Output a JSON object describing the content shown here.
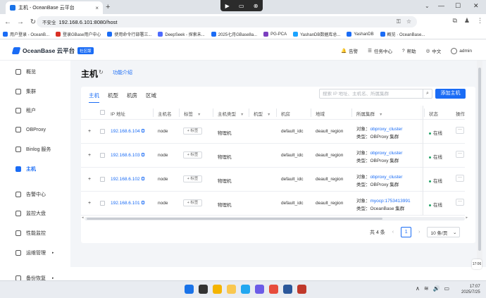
{
  "browser": {
    "tab_title": "主机 - OceanBase 云平台",
    "tab_close": "×",
    "new_tab": "+",
    "tab_search": "⌄",
    "win_min": "—",
    "win_max": "☐",
    "win_close": "✕",
    "back": "←",
    "forward": "→",
    "reload": "↻",
    "security_label": "不安全",
    "url": "192.168.6.101:8080/host",
    "omni_right": [
      "⚿",
      "☆"
    ],
    "right_icons": [
      "⧉",
      "♟",
      "⋮"
    ]
  },
  "overlay_icons": [
    "▶",
    "▭",
    "⊗"
  ],
  "bookmarks": [
    {
      "label": "用户登录 - OceanB...",
      "color": "#1a6cf5"
    },
    {
      "label": "登录GBase用户中心",
      "color": "#d93025"
    },
    {
      "label": "使用命令行部署三...",
      "color": "#1a6cf5"
    },
    {
      "label": "DeepSeek - 探索未...",
      "color": "#4d6bfe"
    },
    {
      "label": "2025七月GBase8a...",
      "color": "#1a6cf5"
    },
    {
      "label": "PG-PCA",
      "color": "#7b3fbf"
    },
    {
      "label": "YashanDB数据库总...",
      "color": "#1aa3ff"
    },
    {
      "label": "YashanDB",
      "color": "#1a6cf5"
    },
    {
      "label": "概览 · OceanBase...",
      "color": "#1a6cf5"
    }
  ],
  "app": {
    "logo_name": "OceanBase 云平台",
    "edition": "社区版",
    "header_items": [
      {
        "icon": "bell-icon",
        "glyph": "🔔",
        "label": "告警"
      },
      {
        "icon": "task-icon",
        "glyph": "☰",
        "label": "任务中心"
      },
      {
        "icon": "help-icon",
        "glyph": "?",
        "label": "帮助"
      },
      {
        "icon": "language-icon",
        "glyph": "◎",
        "label": "中文"
      },
      {
        "icon": "user-icon",
        "glyph": "",
        "label": "admin"
      }
    ]
  },
  "sidebar": {
    "items": [
      {
        "label": "概览",
        "icon": "overview-icon",
        "active": false,
        "arrow": ""
      },
      {
        "label": "集群",
        "icon": "cluster-icon",
        "active": false,
        "arrow": ""
      },
      {
        "label": "租户",
        "icon": "tenant-icon",
        "active": false,
        "arrow": ""
      },
      {
        "label": "OBProxy",
        "icon": "obproxy-icon",
        "active": false,
        "arrow": ""
      },
      {
        "label": "Binlog 服务",
        "icon": "binlog-icon",
        "active": false,
        "arrow": ""
      },
      {
        "label": "主机",
        "icon": "host-icon",
        "active": true,
        "arrow": ""
      },
      {
        "label": "告警中心",
        "icon": "alarm-icon",
        "active": false,
        "arrow": ""
      },
      {
        "label": "监控大盘",
        "icon": "monitor-icon",
        "active": false,
        "arrow": ""
      },
      {
        "label": "性能监控",
        "icon": "performance-icon",
        "active": false,
        "arrow": ""
      },
      {
        "label": "运维管理",
        "icon": "ops-icon",
        "active": false,
        "arrow": "▸"
      },
      {
        "label": "备份恢复",
        "icon": "backup-icon",
        "active": false,
        "arrow": "▸"
      }
    ]
  },
  "page": {
    "title": "主机",
    "refresh_glyph": "↻",
    "intro_link": "功能介绍",
    "tabs": [
      {
        "label": "主机",
        "active": true
      },
      {
        "label": "机型",
        "active": false
      },
      {
        "label": "机房",
        "active": false
      },
      {
        "label": "区域",
        "active": false
      }
    ],
    "search_placeholder": "搜索 IP 地址、主机名、所属集群",
    "search_glyph": "⌕",
    "add_button": "添加主机"
  },
  "table": {
    "columns": [
      "IP 地址",
      "主机名",
      "标签",
      "主机类型",
      "机型",
      "机房",
      "地域",
      "所属集群",
      "状态",
      "操作"
    ],
    "filter_glyph": "▼",
    "rows": [
      {
        "ip": "192.168.6.104",
        "hostname": "node",
        "tag": "+ 标签",
        "type": "物理机",
        "model": "",
        "idc": "default_idc",
        "region": "deault_region",
        "obj_label": "对象：",
        "obj": "obproxy_cluster",
        "kind_label": "类型：",
        "kind": "OBProxy 集群",
        "status": "在线",
        "more": "···"
      },
      {
        "ip": "192.168.6.103",
        "hostname": "node",
        "tag": "+ 标签",
        "type": "物理机",
        "model": "",
        "idc": "default_idc",
        "region": "deault_region",
        "obj_label": "对象：",
        "obj": "obproxy_cluster",
        "kind_label": "类型：",
        "kind": "OBProxy 集群",
        "status": "在线",
        "more": "···"
      },
      {
        "ip": "192.168.6.102",
        "hostname": "node",
        "tag": "+ 标签",
        "type": "物理机",
        "model": "",
        "idc": "default_idc",
        "region": "deault_region",
        "obj_label": "对象：",
        "obj": "obproxy_cluster",
        "kind_label": "类型：",
        "kind": "OBProxy 集群",
        "status": "在线",
        "more": "···"
      },
      {
        "ip": "192.168.6.101",
        "hostname": "node",
        "tag": "+ 标签",
        "type": "物理机",
        "model": "",
        "idc": "default_idc",
        "region": "deault_region",
        "obj_label": "对象：",
        "obj": "myocp:1753413991",
        "kind_label": "类型：",
        "kind": "OceanBase 集群",
        "status": "在线",
        "more": "···"
      }
    ],
    "status_color": "#21a366"
  },
  "pagination": {
    "total": "共 4 条",
    "prev": "‹",
    "page": "1",
    "next": "›",
    "page_size": "10 条/页",
    "page_size_arrow": "⌄"
  },
  "taskbar": {
    "icons": [
      {
        "name": "windows-start-icon",
        "color": "#1a73e8"
      },
      {
        "name": "search-icon",
        "color": "#333333"
      },
      {
        "name": "chrome-icon",
        "color": "#f4b400"
      },
      {
        "name": "file-explorer-icon",
        "color": "#f9c74f"
      },
      {
        "name": "vscode-icon",
        "color": "#22a7f0"
      },
      {
        "name": "snipping-icon",
        "color": "#6c5ce7"
      },
      {
        "name": "game-icon",
        "color": "#e74c3c"
      },
      {
        "name": "word-icon",
        "color": "#2b579a"
      },
      {
        "name": "app-icon",
        "color": "#c0392b"
      }
    ],
    "tray": [
      "∧",
      "≋",
      "🔊",
      "▭"
    ],
    "time": "17:07",
    "date": "2025/7/25",
    "notif": "17:06"
  }
}
